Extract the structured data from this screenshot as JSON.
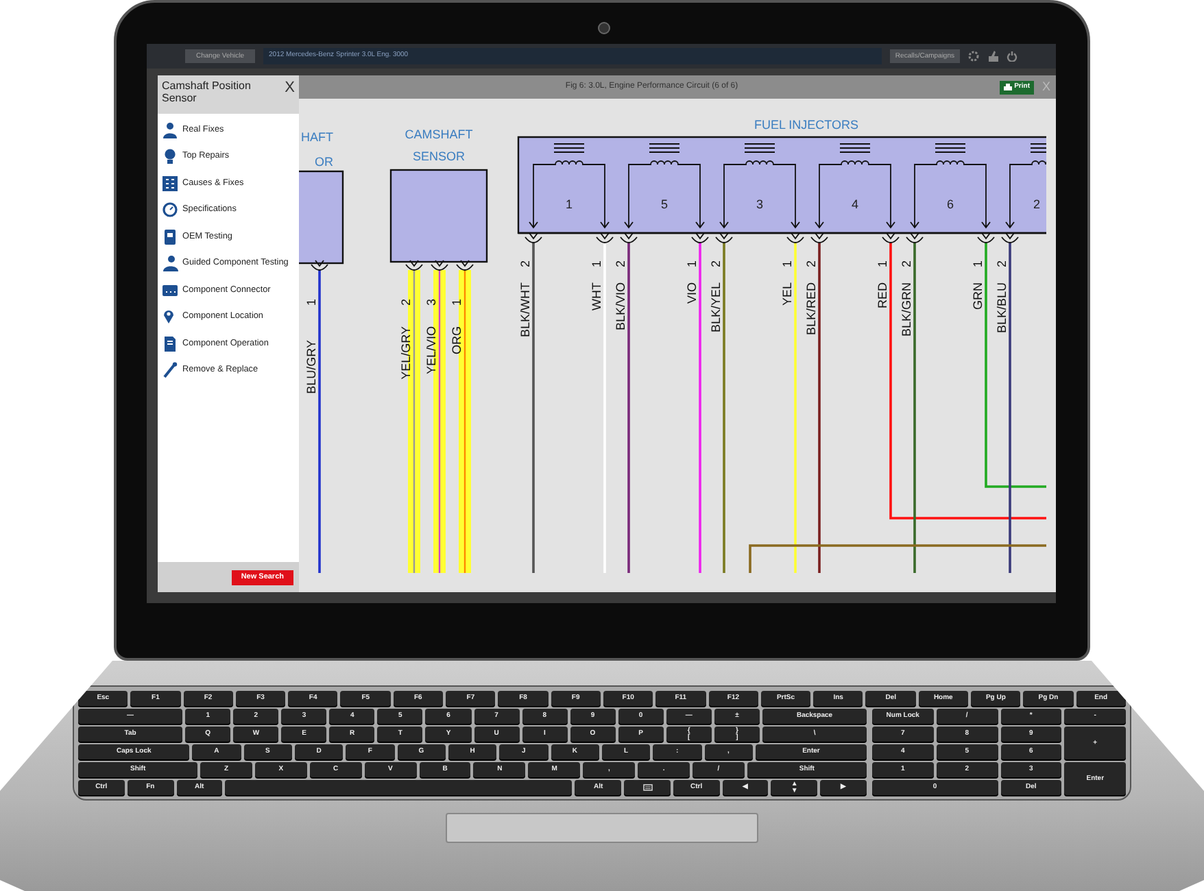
{
  "top_bar": {
    "change_vehicle": "Change Vehicle",
    "vehicle": "2012 Mercedes-Benz Sprinter 3.0L Eng. 3000",
    "recalls": "Recalls/Campaigns"
  },
  "sidebar": {
    "title": "Camshaft Position Sensor",
    "close": "X",
    "items": [
      {
        "label": "Real Fixes"
      },
      {
        "label": "Top Repairs"
      },
      {
        "label": "Causes & Fixes"
      },
      {
        "label": "Specifications"
      },
      {
        "label": "OEM Testing"
      },
      {
        "label": "Guided Component Testing"
      },
      {
        "label": "Component Connector"
      },
      {
        "label": "Component Location"
      },
      {
        "label": "Component Operation"
      },
      {
        "label": "Remove & Replace"
      }
    ],
    "new_search": "New Search"
  },
  "diagram_window": {
    "title": "Fig 6: 3.0L, Engine Performance Circuit (6 of 6)",
    "print": "Print",
    "close": "X",
    "diagram": {
      "partial_component": {
        "label_lines": [
          "HAFT",
          "OR"
        ],
        "pins": [
          {
            "number": "1",
            "wire": "BLU/GRY",
            "color": "#2233cc"
          }
        ]
      },
      "camshaft_sensor": {
        "label_lines": [
          "CAMSHAFT",
          "SENSOR"
        ],
        "pins": [
          {
            "number": "2",
            "wire": "YEL/GRY",
            "color": "#999999"
          },
          {
            "number": "3",
            "wire": "YEL/VIO",
            "color": "#cc44cc"
          },
          {
            "number": "1",
            "wire": "ORG",
            "color": "#ff8800"
          }
        ]
      },
      "fuel_injectors": {
        "label": "FUEL INJECTORS",
        "injectors": [
          {
            "number": "1",
            "pins": [
              {
                "number": "2",
                "wire": "BLK/WHT",
                "color": "#555555"
              },
              {
                "number": "1",
                "wire": "WHT",
                "color": "#ffffff"
              }
            ]
          },
          {
            "number": "5",
            "pins": [
              {
                "number": "2",
                "wire": "BLK/VIO",
                "color": "#7a2a7a"
              },
              {
                "number": "1",
                "wire": "VIO",
                "color": "#ee22ee"
              }
            ]
          },
          {
            "number": "3",
            "pins": [
              {
                "number": "2",
                "wire": "BLK/YEL",
                "color": "#7a7a20"
              },
              {
                "number": "1",
                "wire": "YEL",
                "color": "#ffff33"
              }
            ]
          },
          {
            "number": "4",
            "pins": [
              {
                "number": "2",
                "wire": "BLK/RED",
                "color": "#7a2020"
              },
              {
                "number": "1",
                "wire": "RED",
                "color": "#ff1111"
              }
            ]
          },
          {
            "number": "6",
            "pins": [
              {
                "number": "2",
                "wire": "BLK/GRN",
                "color": "#3a6a2a"
              },
              {
                "number": "1",
                "wire": "GRN",
                "color": "#22aa22"
              }
            ]
          },
          {
            "number": "2",
            "pins": [
              {
                "number": "2",
                "wire": "BLK/BLU",
                "color": "#3a3a7a"
              }
            ]
          }
        ]
      }
    }
  },
  "keyboard": {
    "function_row": [
      {
        "kind": "key",
        "label": "Esc"
      },
      {
        "kind": "key",
        "label": "F1"
      },
      {
        "kind": "key",
        "label": "F2"
      },
      {
        "kind": "key",
        "label": "F3"
      },
      {
        "kind": "key",
        "label": "F4"
      },
      {
        "kind": "key",
        "label": "F5"
      },
      {
        "kind": "key",
        "label": "F6"
      },
      {
        "kind": "key",
        "label": "F7"
      },
      {
        "kind": "key",
        "label": "F8"
      },
      {
        "kind": "key",
        "label": "F9"
      },
      {
        "kind": "key",
        "label": "F10"
      },
      {
        "kind": "key",
        "label": "F11"
      },
      {
        "kind": "key",
        "label": "F12"
      },
      {
        "kind": "key",
        "label": "PrtSc"
      },
      {
        "kind": "key",
        "label": "Ins"
      },
      {
        "kind": "key",
        "label": "Del"
      },
      {
        "kind": "key",
        "label": "Home"
      },
      {
        "kind": "key",
        "label": "Pg Up"
      },
      {
        "kind": "key",
        "label": "Pg Dn"
      },
      {
        "kind": "key",
        "label": "End"
      }
    ],
    "main_rows": [
      [
        {
          "kind": "wide",
          "label": "—"
        },
        {
          "kind": "key",
          "label": "1"
        },
        {
          "kind": "key",
          "label": "2"
        },
        {
          "kind": "key",
          "label": "3"
        },
        {
          "kind": "key",
          "label": "4"
        },
        {
          "kind": "key",
          "label": "5"
        },
        {
          "kind": "key",
          "label": "6"
        },
        {
          "kind": "key",
          "label": "7"
        },
        {
          "kind": "key",
          "label": "8"
        },
        {
          "kind": "key",
          "label": "9"
        },
        {
          "kind": "key",
          "label": "0"
        },
        {
          "kind": "key",
          "label": "—"
        },
        {
          "kind": "key",
          "label": "±"
        },
        {
          "kind": "wide",
          "label": "Backspace"
        }
      ],
      [
        {
          "kind": "wide",
          "label": "Tab"
        },
        {
          "kind": "key",
          "label": "Q"
        },
        {
          "kind": "key",
          "label": "W"
        },
        {
          "kind": "key",
          "label": "E"
        },
        {
          "kind": "key",
          "label": "R"
        },
        {
          "kind": "key",
          "label": "T"
        },
        {
          "kind": "key",
          "label": "Y"
        },
        {
          "kind": "key",
          "label": "U"
        },
        {
          "kind": "key",
          "label": "I"
        },
        {
          "kind": "key",
          "label": "O"
        },
        {
          "kind": "key",
          "label": "P"
        },
        {
          "kind": "key",
          "label": "{\n["
        },
        {
          "kind": "key",
          "label": "}\n]"
        },
        {
          "kind": "wide",
          "label": "\\"
        }
      ],
      [
        {
          "kind": "wide",
          "label": "Caps Lock"
        },
        {
          "kind": "key",
          "label": "A"
        },
        {
          "kind": "key",
          "label": "S"
        },
        {
          "kind": "key",
          "label": "D"
        },
        {
          "kind": "key",
          "label": "F"
        },
        {
          "kind": "key",
          "label": "G"
        },
        {
          "kind": "key",
          "label": "H"
        },
        {
          "kind": "key",
          "label": "J"
        },
        {
          "kind": "key",
          "label": "K"
        },
        {
          "kind": "key",
          "label": "L"
        },
        {
          "kind": "key",
          "label": ":"
        },
        {
          "kind": "key",
          "label": ","
        },
        {
          "kind": "wide",
          "label": "Enter"
        }
      ],
      [
        {
          "kind": "wide",
          "label": "Shift"
        },
        {
          "kind": "key",
          "label": "Z"
        },
        {
          "kind": "key",
          "label": "X"
        },
        {
          "kind": "key",
          "label": "C"
        },
        {
          "kind": "key",
          "label": "V"
        },
        {
          "kind": "key",
          "label": "B"
        },
        {
          "kind": "key",
          "label": "N"
        },
        {
          "kind": "key",
          "label": "M"
        },
        {
          "kind": "key",
          "label": ","
        },
        {
          "kind": "key",
          "label": "."
        },
        {
          "kind": "key",
          "label": "/"
        },
        {
          "kind": "wide",
          "label": "Shift"
        }
      ],
      [
        {
          "kind": "key",
          "label": "Ctrl"
        },
        {
          "kind": "key",
          "label": "Fn"
        },
        {
          "kind": "key",
          "label": "Alt"
        },
        {
          "kind": "space"
        },
        {
          "kind": "key",
          "label": "Alt"
        },
        {
          "kind": "menu"
        },
        {
          "kind": "key",
          "label": "Ctrl"
        },
        {
          "kind": "key",
          "label": "◀"
        },
        {
          "kind": "key",
          "label": "▲\n▼"
        },
        {
          "kind": "key",
          "label": "▶"
        }
      ]
    ],
    "numpad": [
      [
        {
          "kind": "key",
          "label": "Num Lock"
        },
        {
          "kind": "key",
          "label": "/"
        },
        {
          "kind": "key",
          "label": "*"
        },
        {
          "kind": "key",
          "label": "-"
        }
      ],
      [
        {
          "kind": "key",
          "label": "7"
        },
        {
          "kind": "key",
          "label": "8"
        },
        {
          "kind": "key",
          "label": "9"
        },
        {
          "kind": "tall",
          "label": "+"
        }
      ],
      [
        {
          "kind": "key",
          "label": "4"
        },
        {
          "kind": "key",
          "label": "5"
        },
        {
          "kind": "key",
          "label": "6"
        }
      ],
      [
        {
          "kind": "key",
          "label": "1"
        },
        {
          "kind": "key",
          "label": "2"
        },
        {
          "kind": "key",
          "label": "3"
        },
        {
          "kind": "tall",
          "label": "Enter"
        }
      ],
      [
        {
          "kind": "double",
          "label": "0"
        },
        {
          "kind": "key",
          "label": "Del"
        }
      ]
    ]
  }
}
